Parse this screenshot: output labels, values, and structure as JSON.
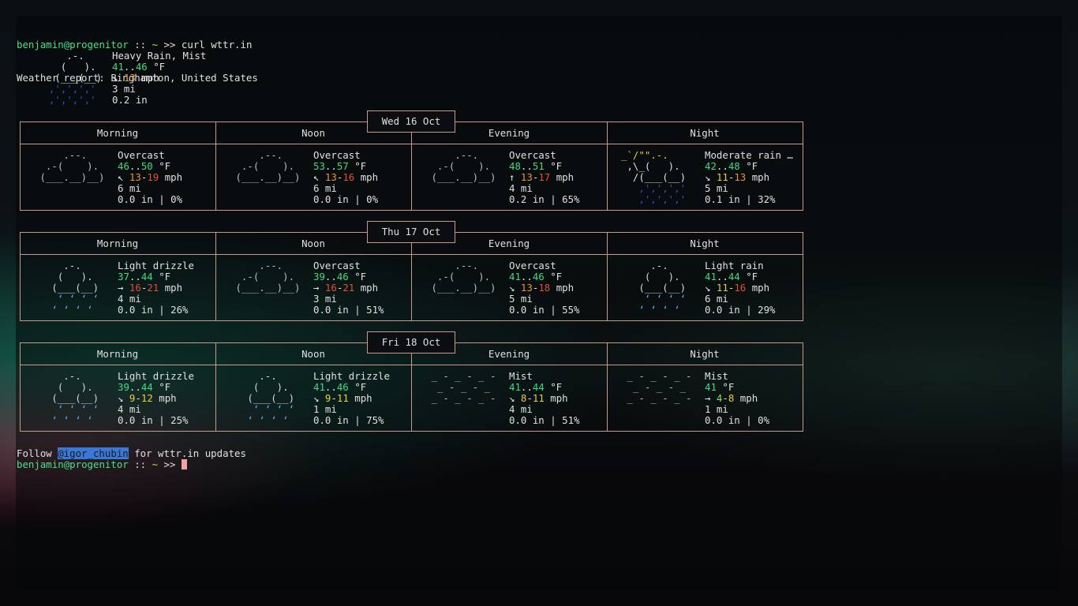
{
  "prompt1": {
    "user": "benjamin",
    "at": "@",
    "host": "progenitor",
    "sep": " :: ",
    "dir": "~",
    "arrow": " >> ",
    "command": "curl wttr.in"
  },
  "report_line": "Weather report: Binghamton, United States",
  "current": {
    "art": [
      "     .-.     ",
      "    (   ).   ",
      "   (___(__)  ",
      "  ‚'‚'‚'‚'  ",
      "  ‚'‚'‚'‚'  "
    ],
    "condition": "Heavy Rain, Mist",
    "temp_lo": "41",
    "temp_sep": "..",
    "temp_hi": "46",
    "temp_unit": " °F",
    "wind_arrow": "↘ ",
    "wind": "13",
    "wind_unit": " mph",
    "visibility": "3 mi",
    "precip": "0.2 in"
  },
  "periods": [
    "Morning",
    "Noon",
    "Evening",
    "Night"
  ],
  "days": [
    {
      "date": "Wed 16 Oct",
      "cells": [
        {
          "art": [
            "     .--.    ",
            "  .-(    ).  ",
            " (___.__)__) "
          ],
          "art_color": "gray",
          "condition": "Overcast",
          "t1": "46",
          "t2": "50",
          "arrow": "↖ ",
          "w1": "13",
          "w2": "19",
          "vis": "6 mi",
          "precip": "0.0 in | 0%"
        },
        {
          "art": [
            "     .--.    ",
            "  .-(    ).  ",
            " (___.__)__) "
          ],
          "art_color": "gray",
          "condition": "Overcast",
          "t1": "53",
          "t2": "57",
          "arrow": "↖ ",
          "w1": "13",
          "w2": "16",
          "vis": "6 mi",
          "precip": "0.0 in | 0%"
        },
        {
          "art": [
            "     .--.    ",
            "  .-(    ).  ",
            " (___.__)__) "
          ],
          "art_color": "gray",
          "condition": "Overcast",
          "t1": "48",
          "t2": "51",
          "arrow": "↑ ",
          "w1": "13",
          "w2": "17",
          "vis": "4 mi",
          "precip": "0.2 in | 65%"
        },
        {
          "art": [
            "_`/\"\".-.    ",
            " ,\\_(   ).  ",
            "  /(___(__) ",
            "   ‚'‚'‚'‚' ",
            "   ‚'‚'‚'‚' "
          ],
          "art_color": "night",
          "condition": "Moderate rain …",
          "t1": "42",
          "t2": "48",
          "arrow": "↘ ",
          "w1": "11",
          "w2": "13",
          "vis": "5 mi",
          "precip": "0.1 in | 32%"
        }
      ]
    },
    {
      "date": "Thu 17 Oct",
      "cells": [
        {
          "art": [
            "     .-.     ",
            "    (   ).   ",
            "   (___(__)  ",
            "    ‘ ‘ ‘ ‘  ",
            "   ‘ ‘ ‘ ‘   "
          ],
          "art_color": "drizzle",
          "condition": "Light drizzle",
          "t1": "37",
          "t2": "44",
          "arrow": "→ ",
          "w1": "16",
          "w2": "21",
          "vis": "4 mi",
          "precip": "0.0 in | 26%"
        },
        {
          "art": [
            "     .--.    ",
            "  .-(    ).  ",
            " (___.__)__) "
          ],
          "art_color": "gray",
          "condition": "Overcast",
          "t1": "39",
          "t2": "46",
          "arrow": "→ ",
          "w1": "16",
          "w2": "21",
          "vis": "3 mi",
          "precip": "0.0 in | 51%"
        },
        {
          "art": [
            "     .--.    ",
            "  .-(    ).  ",
            " (___.__)__) "
          ],
          "art_color": "gray",
          "condition": "Overcast",
          "t1": "41",
          "t2": "46",
          "arrow": "↘ ",
          "w1": "13",
          "w2": "18",
          "vis": "5 mi",
          "precip": "0.0 in | 55%"
        },
        {
          "art": [
            "     .-.     ",
            "    (   ).   ",
            "   (___(__)  ",
            "    ‘ ‘ ‘ ‘  ",
            "   ‘ ‘ ‘ ‘   "
          ],
          "art_color": "drizzle",
          "condition": "Light rain",
          "t1": "41",
          "t2": "44",
          "arrow": "↘ ",
          "w1": "11",
          "w2": "16",
          "vis": "6 mi",
          "precip": "0.0 in | 29%"
        }
      ]
    },
    {
      "date": "Fri 18 Oct",
      "cells": [
        {
          "art": [
            "     .-.     ",
            "    (   ).   ",
            "   (___(__)  ",
            "    ‘ ‘ ‘ ‘  ",
            "   ‘ ‘ ‘ ‘   "
          ],
          "art_color": "drizzle",
          "condition": "Light drizzle",
          "t1": "39",
          "t2": "44",
          "arrow": "↘ ",
          "w1": "9",
          "w2": "12",
          "vis": "4 mi",
          "precip": "0.0 in | 25%"
        },
        {
          "art": [
            "     .-.     ",
            "    (   ).   ",
            "   (___(__)  ",
            "    ‘ ‘ ‘ ‘  ",
            "   ‘ ‘ ‘ ‘   "
          ],
          "art_color": "drizzle",
          "condition": "Light drizzle",
          "t1": "41",
          "t2": "46",
          "arrow": "↘ ",
          "w1": "9",
          "w2": "11",
          "vis": "1 mi",
          "precip": "0.0 in | 75%"
        },
        {
          "art": [
            " _ - _ - _ - ",
            "  _ - _ - _  ",
            " _ - _ - _ - "
          ],
          "art_color": "gray",
          "condition": "Mist",
          "t1": "41",
          "t2": "44",
          "arrow": "↘ ",
          "w1": "8",
          "w2": "11",
          "vis": "4 mi",
          "precip": "0.0 in | 51%"
        },
        {
          "art": [
            " _ - _ - _ - ",
            "  _ - _ - _  ",
            " _ - _ - _ - "
          ],
          "art_color": "gray",
          "condition": "Mist",
          "t1": "41",
          "t2": "",
          "arrow": "→ ",
          "w1": "4",
          "w2": "8",
          "vis": "1 mi",
          "precip": "0.0 in | 0%"
        }
      ]
    }
  ],
  "footer": {
    "pre": "Follow ",
    "handle": "@igor_chubin",
    "post": " for wttr.in updates"
  },
  "prompt2": {
    "user": "benjamin",
    "at": "@",
    "host": "progenitor",
    "sep": " :: ",
    "dir": "~",
    "arrow": " >> "
  },
  "colors": {
    "border": "#c89a8e",
    "temp_green": "#3ddc84",
    "wind_orange": "#e89a2a",
    "wind_red": "#e2502f",
    "rain_blue": "#2c4fd8",
    "cursor": "#f0a3a3"
  }
}
